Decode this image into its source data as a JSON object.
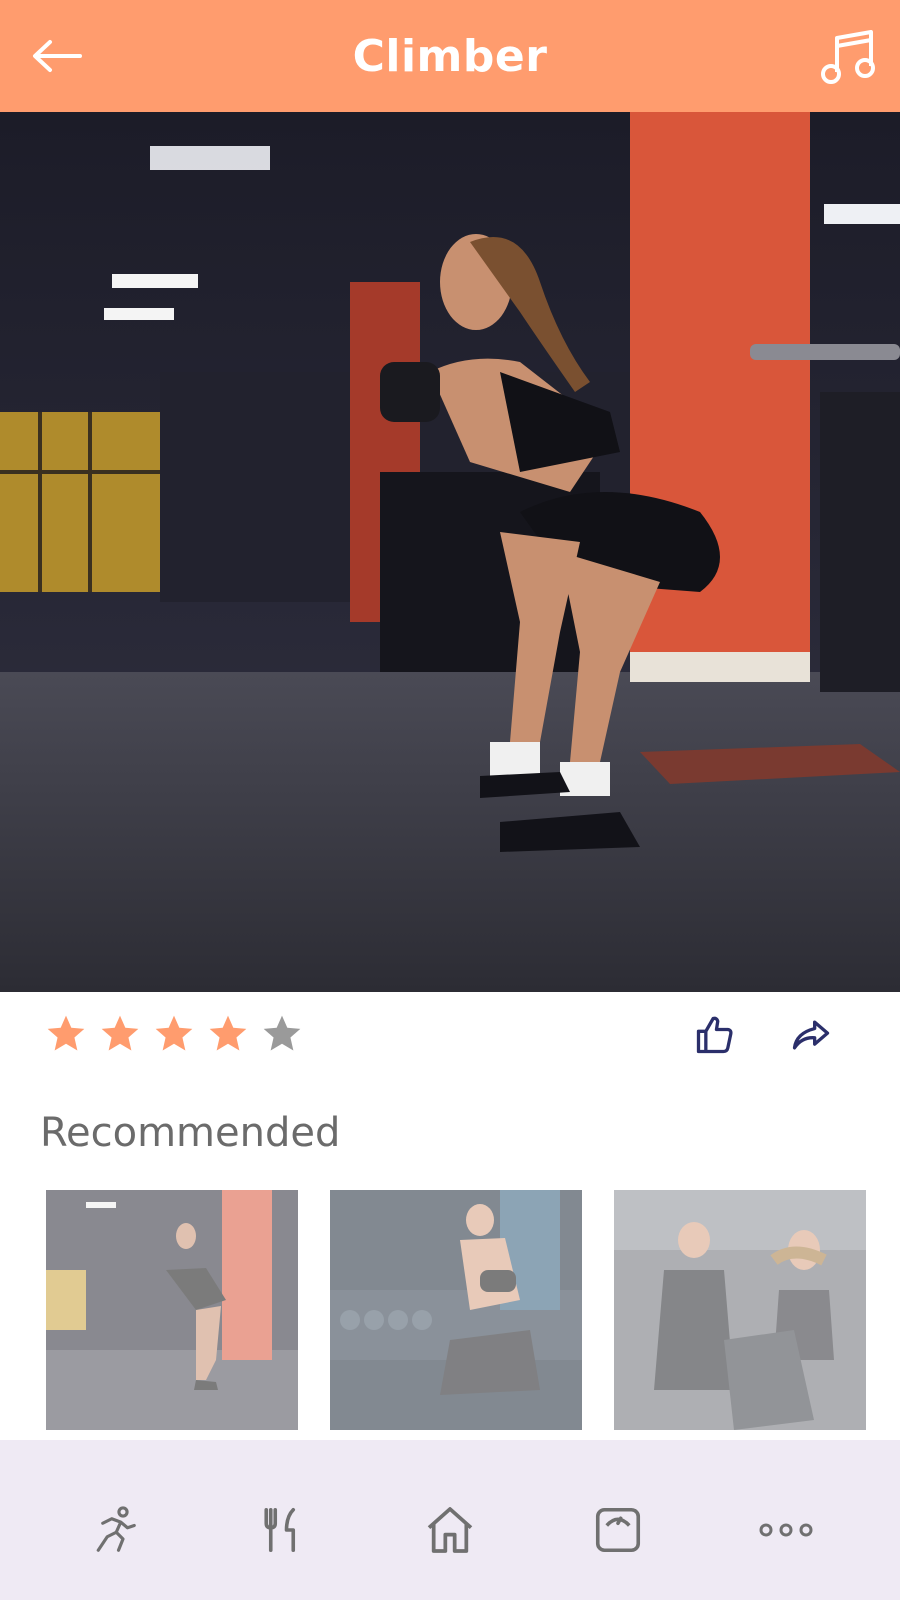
{
  "header": {
    "title": "Climber",
    "back_icon": "arrow-left-icon",
    "music_icon": "music-note-icon",
    "background_color": "#FF9C6E"
  },
  "hero": {
    "image": "woman-squatting-in-gym"
  },
  "rating": {
    "value": 4,
    "max": 5,
    "filled_color": "#FF9C6E",
    "empty_color": "#9a9a9a"
  },
  "actions": {
    "like_icon": "thumbs-up-icon",
    "share_icon": "share-arrow-icon",
    "icon_color": "#2B2F6B"
  },
  "recommended": {
    "title": "Recommended",
    "items": [
      {
        "image": "woman-squatting-in-gym"
      },
      {
        "image": "man-dumbbell-row-on-bench"
      },
      {
        "image": "couple-on-exercise-bikes"
      }
    ]
  },
  "bottom_nav": {
    "items": [
      {
        "icon": "running-icon"
      },
      {
        "icon": "fork-knife-icon"
      },
      {
        "icon": "home-icon"
      },
      {
        "icon": "scale-icon"
      },
      {
        "icon": "more-dots-icon"
      }
    ],
    "background_color": "#EFEAF4",
    "icon_color": "#707070"
  }
}
